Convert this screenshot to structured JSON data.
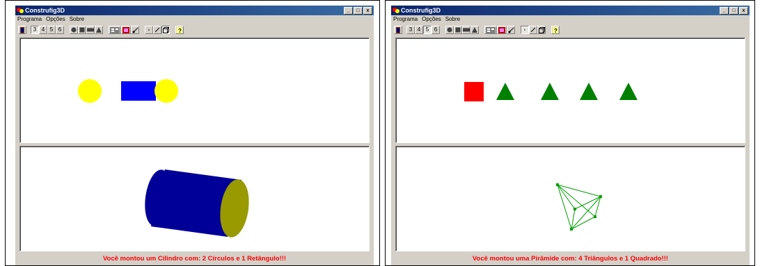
{
  "windows": [
    {
      "title": "Construfig3D",
      "menu": [
        "Programa",
        "Opções",
        "Sobre"
      ],
      "toolbar": {
        "sides": [
          "3",
          "4",
          "5",
          "6"
        ],
        "pressed_side": 0
      },
      "window_controls": [
        "_",
        "□",
        "x"
      ],
      "status": "Você montou um Cilindro com: 2 Círculos e 1 Retângulo!!!",
      "colors": {
        "shape_yellow": "#ffff00",
        "shape_blue": "#0000ff",
        "cylinder_body": "#000099",
        "cylinder_cap": "#999900"
      }
    },
    {
      "title": "Construfig3D",
      "menu": [
        "Programa",
        "Opções",
        "Sobre"
      ],
      "toolbar": {
        "sides": [
          "3",
          "4",
          "5",
          "6"
        ],
        "pressed_side": 2
      },
      "window_controls": [
        "_",
        "□",
        "x"
      ],
      "status": "Você montou uma Pirâmide com: 4 Triângulos e 1 Quadrado!!!",
      "colors": {
        "square": "#ff0000",
        "triangle": "#008000",
        "wire": "#00a000"
      }
    }
  ]
}
